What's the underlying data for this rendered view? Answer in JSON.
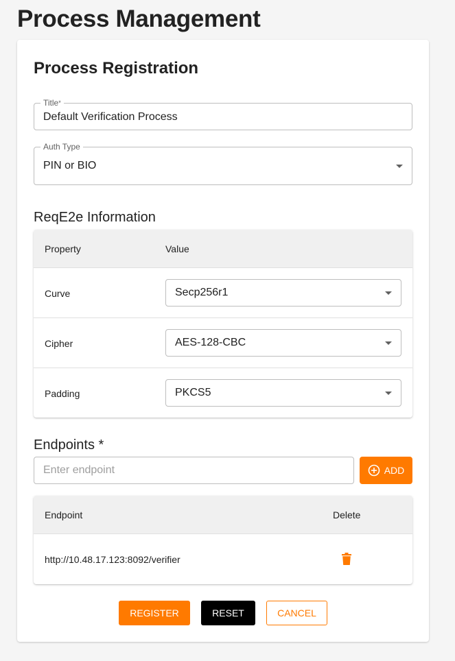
{
  "page": {
    "title": "Process Management"
  },
  "form": {
    "title": "Process Registration",
    "title_field": {
      "label": "Title",
      "required_mark": "*",
      "value": "Default Verification Process"
    },
    "auth_type": {
      "label": "Auth Type",
      "value": "PIN or BIO"
    }
  },
  "reqe2e": {
    "title": "ReqE2e Information",
    "headers": {
      "property": "Property",
      "value": "Value"
    },
    "rows": [
      {
        "property": "Curve",
        "value": "Secp256r1"
      },
      {
        "property": "Cipher",
        "value": "AES-128-CBC"
      },
      {
        "property": "Padding",
        "value": "PKCS5"
      }
    ]
  },
  "endpoints": {
    "title": "Endpoints *",
    "input_placeholder": "Enter endpoint",
    "add_label": "ADD",
    "headers": {
      "endpoint": "Endpoint",
      "delete": "Delete"
    },
    "rows": [
      {
        "endpoint": "http://10.48.17.123:8092/verifier",
        "delete_icon": "trash-icon"
      }
    ]
  },
  "actions": {
    "register": "REGISTER",
    "reset": "RESET",
    "cancel": "CANCEL"
  },
  "colors": {
    "accent": "#ff7a00",
    "dark_button": "#000000",
    "header_bg": "#f0f0f0"
  }
}
